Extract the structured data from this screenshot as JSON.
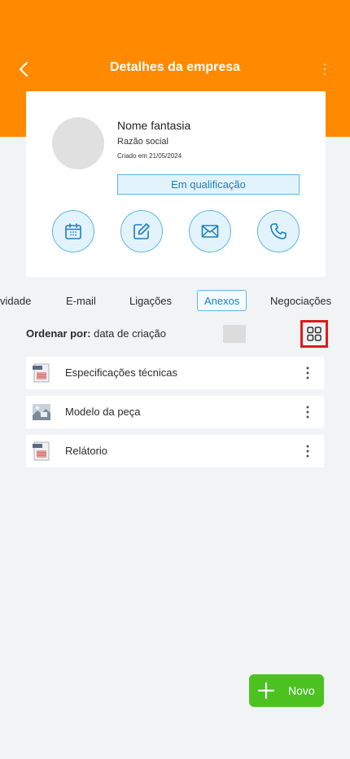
{
  "header": {
    "title": "Detalhes da empresa",
    "color": "#ff8a00"
  },
  "company": {
    "trade_name": "Nome fantasia",
    "legal_name": "Razão social",
    "created": "Criado em 21/05/2024",
    "status": "Em qualificação"
  },
  "actions": [
    {
      "icon": "calendar-icon"
    },
    {
      "icon": "edit-icon"
    },
    {
      "icon": "mail-icon"
    },
    {
      "icon": "phone-icon"
    }
  ],
  "tabs": [
    {
      "label": "vidade",
      "active": false
    },
    {
      "label": "E-mail",
      "active": false
    },
    {
      "label": "Ligações",
      "active": false
    },
    {
      "label": "Anexos",
      "active": true
    },
    {
      "label": "Negociações",
      "active": false
    }
  ],
  "sort": {
    "prefix": "Ordenar por:",
    "value": "data de criação"
  },
  "files": [
    {
      "name": "Especificações técnicas",
      "icon": "pdf-file-icon"
    },
    {
      "name": "Modelo da peça",
      "icon": "image-file-icon"
    },
    {
      "name": "Relátorio",
      "icon": "pdf-file-icon"
    }
  ],
  "fab": {
    "label": "Novo",
    "color": "#4cc221"
  }
}
